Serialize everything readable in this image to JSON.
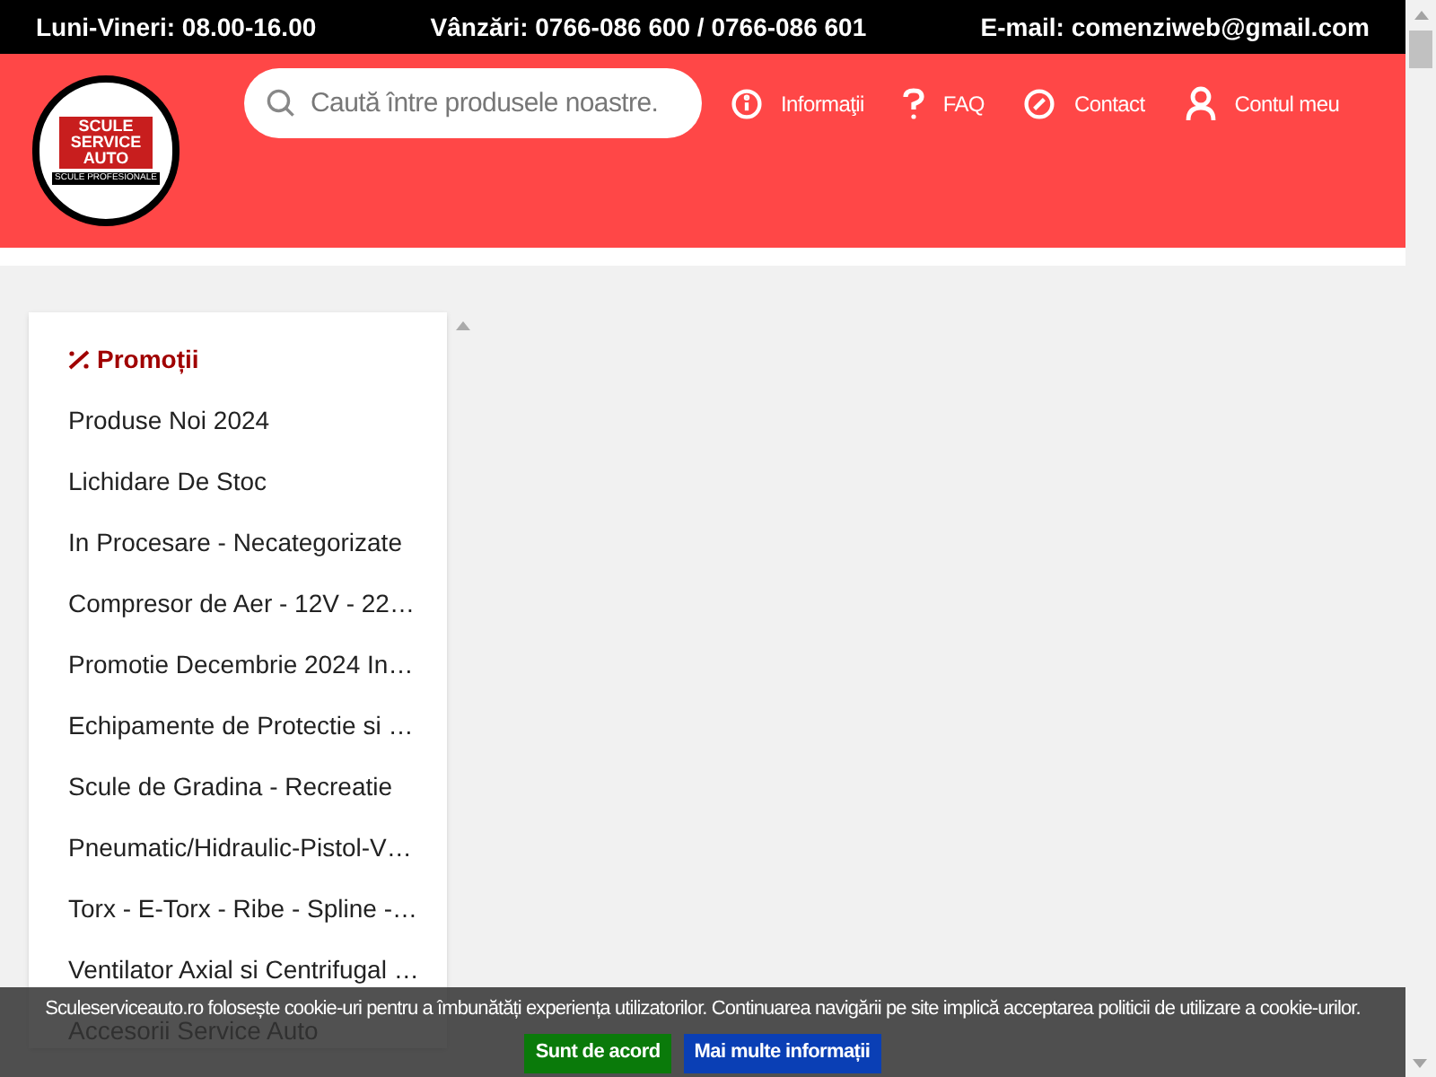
{
  "top_bar": {
    "hours": "Luni-Vineri: 08.00-16.00",
    "sales": "Vânzări: 0766-086 600 / 0766-086 601",
    "email": "E-mail: comenziweb@gmail.com"
  },
  "logo": {
    "lines": [
      "SCULE",
      "SERVICE",
      "AUTO"
    ],
    "ribbon": "SCULE PROFESIONALE"
  },
  "search": {
    "placeholder": "Caută între produsele noastre."
  },
  "nav": [
    {
      "label": "Informaţii",
      "kind": "info"
    },
    {
      "label": "FAQ",
      "kind": "faq"
    },
    {
      "label": "Contact",
      "kind": "contact"
    },
    {
      "label": "Contul meu",
      "kind": "account"
    }
  ],
  "sidebar": {
    "items": [
      {
        "label": "Promoții",
        "kind": "promo"
      },
      {
        "label": "Produse Noi 2024",
        "kind": "plain"
      },
      {
        "label": "Lichidare De Stoc",
        "kind": "plain"
      },
      {
        "label": "In Procesare - Necategorizate",
        "kind": "plain"
      },
      {
        "label": "Compresor de Aer - 12V - 22…",
        "kind": "plain"
      },
      {
        "label": "Promotie Decembrie 2024 In…",
        "kind": "plain"
      },
      {
        "label": "Echipamente de Protectie si …",
        "kind": "plain"
      },
      {
        "label": "Scule de Gradina - Recreatie",
        "kind": "plain"
      },
      {
        "label": "Pneumatic/Hidraulic-Pistol-V…",
        "kind": "plain"
      },
      {
        "label": "Torx - E-Torx - Ribe - Spline -…",
        "kind": "plain"
      },
      {
        "label": "Ventilator Axial si Centrifugal …",
        "kind": "plain"
      },
      {
        "label": "Accesorii Service Auto",
        "kind": "plain"
      }
    ]
  },
  "cookie_banner": {
    "text": "Sculeserviceauto.ro folosește cookie-uri pentru a îmbunătăți experiența utilizatorilor. Continuarea navigării pe site implică acceptarea politicii de utilizare a cookie-urilor.",
    "buttons": [
      {
        "label": "Sunt de acord",
        "kind": "accept"
      },
      {
        "label": "Mai multe informații",
        "kind": "info"
      }
    ]
  }
}
